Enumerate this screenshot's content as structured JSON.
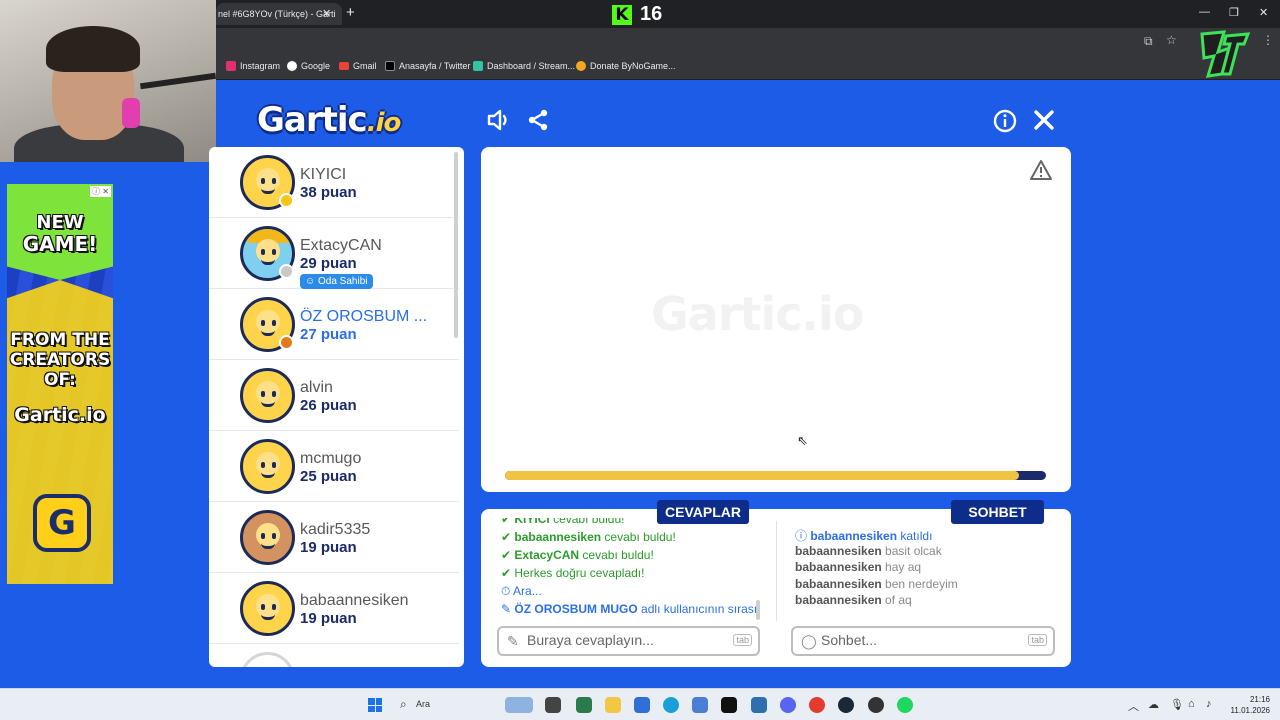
{
  "browser": {
    "tab_title": "nel #6G8YOv (Türkçe) - Garti",
    "kick_viewers": "16",
    "bookmarks": [
      "Instagram",
      "Google",
      "Gmail",
      "Anasayfa / Twitter",
      "Dashboard / Stream...",
      "Donate ByNoGame..."
    ]
  },
  "ad": {
    "line1": "NEW",
    "line2": "GAME!",
    "line3": "FROM THE",
    "line4": "CREATORS",
    "line5": "OF:",
    "brand": "Gartic.io",
    "app_letter": "G"
  },
  "header": {
    "logo_main": "Gartic",
    "logo_suffix": ".io"
  },
  "players": [
    {
      "name": "KIYICI",
      "points": "38 puan",
      "status_color": "#f5c518",
      "avatar": "plain",
      "drawing": false,
      "owner": false
    },
    {
      "name": "ExtacyCAN",
      "points": "29 puan",
      "status_color": "#c9c9c9",
      "avatar": "cap",
      "drawing": false,
      "owner": true
    },
    {
      "name": "ÖZ OROSBUM ...",
      "points": "27 puan",
      "status_color": "#e07a1a",
      "avatar": "plain",
      "drawing": true,
      "owner": false
    },
    {
      "name": "alvin",
      "points": "26 puan",
      "status_color": "",
      "avatar": "plain",
      "drawing": false,
      "owner": false
    },
    {
      "name": "mcmugo",
      "points": "25 puan",
      "status_color": "",
      "avatar": "plain",
      "drawing": false,
      "owner": false
    },
    {
      "name": "kadir5335",
      "points": "19 puan",
      "status_color": "",
      "avatar": "brown",
      "drawing": false,
      "owner": false
    },
    {
      "name": "babaannesiken",
      "points": "19 puan",
      "status_color": "",
      "avatar": "plain",
      "drawing": false,
      "owner": false
    }
  ],
  "owner_badge": "Oda Sahibi",
  "canvas": {
    "watermark": "Gartic.io",
    "timer_remaining": 0.95
  },
  "answers": {
    "tab_label": "CEVAPLAR",
    "lines": [
      {
        "type": "found",
        "user": "KIYICI",
        "text": " cevabı buldu!"
      },
      {
        "type": "found",
        "user": "babaannesiken",
        "text": " cevabı buldu!"
      },
      {
        "type": "found",
        "user": "ExtacyCAN",
        "text": " cevabı buldu!"
      },
      {
        "type": "found",
        "user": "",
        "text": "Herkes doğru cevapladı!"
      },
      {
        "type": "time",
        "user": "",
        "text": "Ara..."
      },
      {
        "type": "turn",
        "user": "ÖZ OROSBUM MUGO",
        "text": " adlı kullanıcının sırası"
      }
    ],
    "placeholder": "Buraya cevaplayın...",
    "tab_hint": "tab"
  },
  "chat": {
    "tab_label": "SOHBET",
    "lines": [
      {
        "type": "info",
        "user": "babaannesiken",
        "text": " katıldı"
      },
      {
        "type": "msg",
        "user": "babaannesiken",
        "text": " basit olcak"
      },
      {
        "type": "msg",
        "user": "babaannesiken",
        "text": " hay aq"
      },
      {
        "type": "msg",
        "user": "babaannesiken",
        "text": " ben nerdeyim"
      },
      {
        "type": "msg",
        "user": "babaannesiken",
        "text": " of aq"
      }
    ],
    "placeholder": "Sohbet...",
    "tab_hint": "tab"
  },
  "taskbar": {
    "search_label": "Ara",
    "time": "21:16",
    "date": "11.01.2026"
  },
  "colors": {
    "background": "#1d5ce6",
    "navy": "#0e2c8a",
    "answer_green": "#2c9c2c",
    "info_blue": "#2c6ee8",
    "timer_yellow": "#f0c440"
  }
}
